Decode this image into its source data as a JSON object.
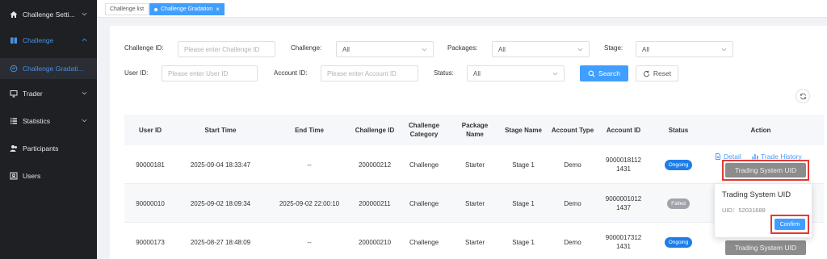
{
  "sidebar": {
    "items": [
      {
        "label": "Challenge Setti...",
        "icon": "home-icon"
      },
      {
        "label": "Challenge",
        "icon": "book-icon"
      },
      {
        "label": "Challenge Gradati...",
        "icon": "gradation-icon"
      },
      {
        "label": "Trader",
        "icon": "monitor-icon"
      },
      {
        "label": "Statistics",
        "icon": "list-icon"
      },
      {
        "label": "Participants",
        "icon": "users-icon"
      },
      {
        "label": "Users",
        "icon": "user-card-icon"
      }
    ]
  },
  "tabs": [
    {
      "label": "Challenge list"
    },
    {
      "label": "Challenge Gradation",
      "close": "×"
    }
  ],
  "filters": {
    "challenge_id": {
      "label": "Challenge ID:",
      "placeholder": "Please enter Challenge ID"
    },
    "challenge": {
      "label": "Challenge:",
      "value": "All"
    },
    "packages": {
      "label": "Packages:",
      "value": "All"
    },
    "stage": {
      "label": "Stage:",
      "value": "All"
    },
    "user_id": {
      "label": "User ID:",
      "placeholder": "Please enter User ID"
    },
    "account_id": {
      "label": "Account ID:",
      "placeholder": "Please enter Account ID"
    },
    "status": {
      "label": "Status:",
      "value": "All"
    },
    "search_label": "Search",
    "reset_label": "Reset"
  },
  "table": {
    "headers": [
      "User ID",
      "Start Time",
      "End Time",
      "Challenge ID",
      "Challenge Category",
      "Package Name",
      "Stage Name",
      "Account Type",
      "Account ID",
      "Status",
      "Action"
    ],
    "rows": [
      {
        "user_id": "90000181",
        "start": "2025-09-04 18:33:47",
        "end": "--",
        "challenge_id": "200000212",
        "category": "Challenge",
        "package": "Starter",
        "stage": "Stage 1",
        "type": "Demo",
        "account_id_1": "9000018112",
        "account_id_2": "1431",
        "status": "Ongoing"
      },
      {
        "user_id": "90000010",
        "start": "2025-09-02 18:09:34",
        "end": "2025-09-02 22:00:10",
        "challenge_id": "200000211",
        "category": "Challenge",
        "package": "Starter",
        "stage": "Stage 1",
        "type": "Demo",
        "account_id_1": "9000001012",
        "account_id_2": "1437",
        "status": "Failed"
      },
      {
        "user_id": "90000173",
        "start": "2025-08-27 18:48:09",
        "end": "--",
        "challenge_id": "200000210",
        "category": "Challenge",
        "package": "Starter",
        "stage": "Stage 1",
        "type": "Demo",
        "account_id_1": "9000017312",
        "account_id_2": "1431",
        "status": "Ongoing"
      }
    ],
    "actions": {
      "detail": "Detail",
      "trade_history": "Trade History",
      "trading_system_uid": "Trading System UID"
    }
  },
  "popover": {
    "title": "Trading System UID",
    "uid_text": "UID：52031688",
    "confirm": "Confirm"
  },
  "colors": {
    "accent": "#409eff",
    "sidebar_bg": "#1f2024",
    "highlight": "#e53935"
  }
}
